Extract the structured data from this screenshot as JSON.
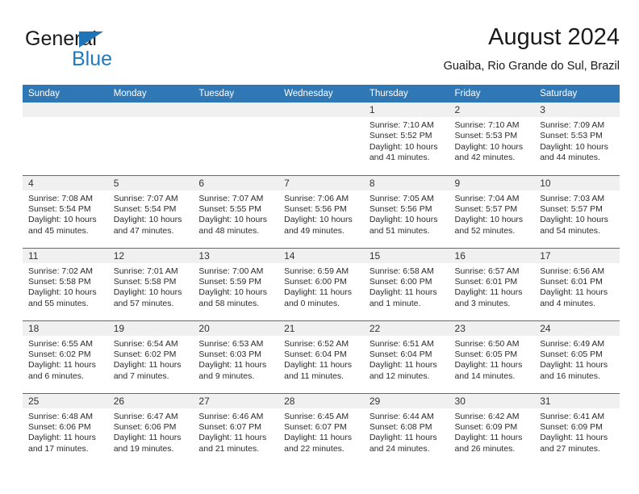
{
  "brand": {
    "line1": "General",
    "line2": "Blue",
    "triangle_color": "#1f73b7",
    "text_color": "#1a1a1a",
    "blue_color": "#1f7ac1"
  },
  "header": {
    "title": "August 2024",
    "subtitle": "Guaiba, Rio Grande do Sul, Brazil"
  },
  "colors": {
    "header_blue": "#3077b5",
    "daynum_band": "#f0f0f0",
    "text": "#2b2b2b"
  },
  "weekday_headers": [
    "Sunday",
    "Monday",
    "Tuesday",
    "Wednesday",
    "Thursday",
    "Friday",
    "Saturday"
  ],
  "weeks": [
    [
      {
        "day": "",
        "sunrise": "",
        "sunset": "",
        "daylight_line1": "",
        "daylight_line2": ""
      },
      {
        "day": "",
        "sunrise": "",
        "sunset": "",
        "daylight_line1": "",
        "daylight_line2": ""
      },
      {
        "day": "",
        "sunrise": "",
        "sunset": "",
        "daylight_line1": "",
        "daylight_line2": ""
      },
      {
        "day": "",
        "sunrise": "",
        "sunset": "",
        "daylight_line1": "",
        "daylight_line2": ""
      },
      {
        "day": "1",
        "sunrise": "Sunrise: 7:10 AM",
        "sunset": "Sunset: 5:52 PM",
        "daylight_line1": "Daylight: 10 hours",
        "daylight_line2": "and 41 minutes."
      },
      {
        "day": "2",
        "sunrise": "Sunrise: 7:10 AM",
        "sunset": "Sunset: 5:53 PM",
        "daylight_line1": "Daylight: 10 hours",
        "daylight_line2": "and 42 minutes."
      },
      {
        "day": "3",
        "sunrise": "Sunrise: 7:09 AM",
        "sunset": "Sunset: 5:53 PM",
        "daylight_line1": "Daylight: 10 hours",
        "daylight_line2": "and 44 minutes."
      }
    ],
    [
      {
        "day": "4",
        "sunrise": "Sunrise: 7:08 AM",
        "sunset": "Sunset: 5:54 PM",
        "daylight_line1": "Daylight: 10 hours",
        "daylight_line2": "and 45 minutes."
      },
      {
        "day": "5",
        "sunrise": "Sunrise: 7:07 AM",
        "sunset": "Sunset: 5:54 PM",
        "daylight_line1": "Daylight: 10 hours",
        "daylight_line2": "and 47 minutes."
      },
      {
        "day": "6",
        "sunrise": "Sunrise: 7:07 AM",
        "sunset": "Sunset: 5:55 PM",
        "daylight_line1": "Daylight: 10 hours",
        "daylight_line2": "and 48 minutes."
      },
      {
        "day": "7",
        "sunrise": "Sunrise: 7:06 AM",
        "sunset": "Sunset: 5:56 PM",
        "daylight_line1": "Daylight: 10 hours",
        "daylight_line2": "and 49 minutes."
      },
      {
        "day": "8",
        "sunrise": "Sunrise: 7:05 AM",
        "sunset": "Sunset: 5:56 PM",
        "daylight_line1": "Daylight: 10 hours",
        "daylight_line2": "and 51 minutes."
      },
      {
        "day": "9",
        "sunrise": "Sunrise: 7:04 AM",
        "sunset": "Sunset: 5:57 PM",
        "daylight_line1": "Daylight: 10 hours",
        "daylight_line2": "and 52 minutes."
      },
      {
        "day": "10",
        "sunrise": "Sunrise: 7:03 AM",
        "sunset": "Sunset: 5:57 PM",
        "daylight_line1": "Daylight: 10 hours",
        "daylight_line2": "and 54 minutes."
      }
    ],
    [
      {
        "day": "11",
        "sunrise": "Sunrise: 7:02 AM",
        "sunset": "Sunset: 5:58 PM",
        "daylight_line1": "Daylight: 10 hours",
        "daylight_line2": "and 55 minutes."
      },
      {
        "day": "12",
        "sunrise": "Sunrise: 7:01 AM",
        "sunset": "Sunset: 5:58 PM",
        "daylight_line1": "Daylight: 10 hours",
        "daylight_line2": "and 57 minutes."
      },
      {
        "day": "13",
        "sunrise": "Sunrise: 7:00 AM",
        "sunset": "Sunset: 5:59 PM",
        "daylight_line1": "Daylight: 10 hours",
        "daylight_line2": "and 58 minutes."
      },
      {
        "day": "14",
        "sunrise": "Sunrise: 6:59 AM",
        "sunset": "Sunset: 6:00 PM",
        "daylight_line1": "Daylight: 11 hours",
        "daylight_line2": "and 0 minutes."
      },
      {
        "day": "15",
        "sunrise": "Sunrise: 6:58 AM",
        "sunset": "Sunset: 6:00 PM",
        "daylight_line1": "Daylight: 11 hours",
        "daylight_line2": "and 1 minute."
      },
      {
        "day": "16",
        "sunrise": "Sunrise: 6:57 AM",
        "sunset": "Sunset: 6:01 PM",
        "daylight_line1": "Daylight: 11 hours",
        "daylight_line2": "and 3 minutes."
      },
      {
        "day": "17",
        "sunrise": "Sunrise: 6:56 AM",
        "sunset": "Sunset: 6:01 PM",
        "daylight_line1": "Daylight: 11 hours",
        "daylight_line2": "and 4 minutes."
      }
    ],
    [
      {
        "day": "18",
        "sunrise": "Sunrise: 6:55 AM",
        "sunset": "Sunset: 6:02 PM",
        "daylight_line1": "Daylight: 11 hours",
        "daylight_line2": "and 6 minutes."
      },
      {
        "day": "19",
        "sunrise": "Sunrise: 6:54 AM",
        "sunset": "Sunset: 6:02 PM",
        "daylight_line1": "Daylight: 11 hours",
        "daylight_line2": "and 7 minutes."
      },
      {
        "day": "20",
        "sunrise": "Sunrise: 6:53 AM",
        "sunset": "Sunset: 6:03 PM",
        "daylight_line1": "Daylight: 11 hours",
        "daylight_line2": "and 9 minutes."
      },
      {
        "day": "21",
        "sunrise": "Sunrise: 6:52 AM",
        "sunset": "Sunset: 6:04 PM",
        "daylight_line1": "Daylight: 11 hours",
        "daylight_line2": "and 11 minutes."
      },
      {
        "day": "22",
        "sunrise": "Sunrise: 6:51 AM",
        "sunset": "Sunset: 6:04 PM",
        "daylight_line1": "Daylight: 11 hours",
        "daylight_line2": "and 12 minutes."
      },
      {
        "day": "23",
        "sunrise": "Sunrise: 6:50 AM",
        "sunset": "Sunset: 6:05 PM",
        "daylight_line1": "Daylight: 11 hours",
        "daylight_line2": "and 14 minutes."
      },
      {
        "day": "24",
        "sunrise": "Sunrise: 6:49 AM",
        "sunset": "Sunset: 6:05 PM",
        "daylight_line1": "Daylight: 11 hours",
        "daylight_line2": "and 16 minutes."
      }
    ],
    [
      {
        "day": "25",
        "sunrise": "Sunrise: 6:48 AM",
        "sunset": "Sunset: 6:06 PM",
        "daylight_line1": "Daylight: 11 hours",
        "daylight_line2": "and 17 minutes."
      },
      {
        "day": "26",
        "sunrise": "Sunrise: 6:47 AM",
        "sunset": "Sunset: 6:06 PM",
        "daylight_line1": "Daylight: 11 hours",
        "daylight_line2": "and 19 minutes."
      },
      {
        "day": "27",
        "sunrise": "Sunrise: 6:46 AM",
        "sunset": "Sunset: 6:07 PM",
        "daylight_line1": "Daylight: 11 hours",
        "daylight_line2": "and 21 minutes."
      },
      {
        "day": "28",
        "sunrise": "Sunrise: 6:45 AM",
        "sunset": "Sunset: 6:07 PM",
        "daylight_line1": "Daylight: 11 hours",
        "daylight_line2": "and 22 minutes."
      },
      {
        "day": "29",
        "sunrise": "Sunrise: 6:44 AM",
        "sunset": "Sunset: 6:08 PM",
        "daylight_line1": "Daylight: 11 hours",
        "daylight_line2": "and 24 minutes."
      },
      {
        "day": "30",
        "sunrise": "Sunrise: 6:42 AM",
        "sunset": "Sunset: 6:09 PM",
        "daylight_line1": "Daylight: 11 hours",
        "daylight_line2": "and 26 minutes."
      },
      {
        "day": "31",
        "sunrise": "Sunrise: 6:41 AM",
        "sunset": "Sunset: 6:09 PM",
        "daylight_line1": "Daylight: 11 hours",
        "daylight_line2": "and 27 minutes."
      }
    ]
  ]
}
